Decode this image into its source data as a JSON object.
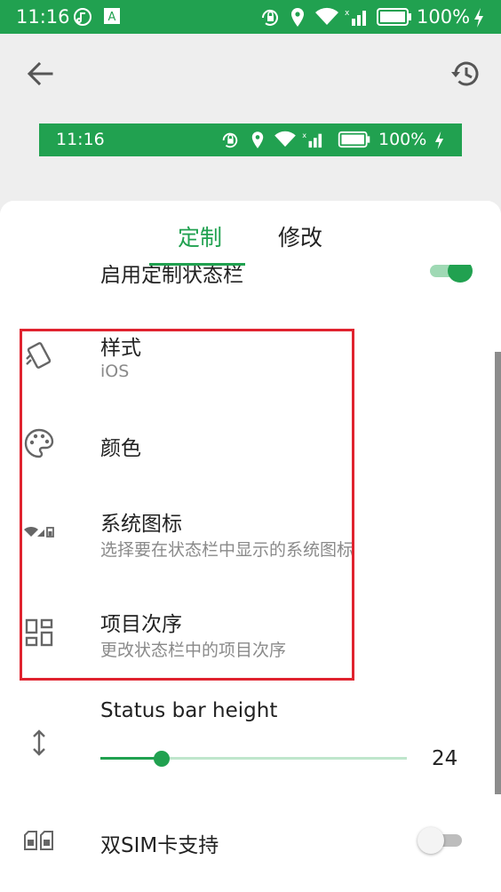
{
  "status_bar": {
    "time": "11:16",
    "battery": "100%",
    "icons": [
      "music-icon",
      "a-badge-icon",
      "rotation-lock-icon",
      "location-icon",
      "wifi-icon",
      "signal-icon",
      "battery-icon",
      "charging-icon"
    ]
  },
  "toolbar": {
    "back_icon": "arrow-left-icon",
    "reset_icon": "restore-icon"
  },
  "preview": {
    "time": "11:16",
    "battery": "100%"
  },
  "tabs": [
    {
      "label": "定制",
      "active": true
    },
    {
      "label": "修改",
      "active": false
    }
  ],
  "settings": {
    "enable_custom_status_bar": {
      "label": "启用定制状态栏",
      "enabled": true
    },
    "style": {
      "title": "样式",
      "value": "iOS",
      "icon": "card-icon"
    },
    "color": {
      "title": "颜色",
      "icon": "palette-icon"
    },
    "system_icons": {
      "title": "系统图标",
      "subtitle": "选择要在状态栏中显示的系统图标",
      "icon": "status-icons-icon"
    },
    "item_order": {
      "title": "项目次序",
      "subtitle": "更改状态栏中的项目次序",
      "icon": "dashboard-icon"
    },
    "status_bar_height": {
      "title": "Status bar height",
      "value": 24,
      "value_text": "24",
      "fraction": 0.2,
      "icon": "vertical-arrows-icon"
    },
    "dual_sim": {
      "title": "双SIM卡支持",
      "enabled": false,
      "icon": "dual-sim-icon"
    }
  },
  "colors": {
    "accent": "#21a150",
    "highlight_border": "#e0232f"
  }
}
